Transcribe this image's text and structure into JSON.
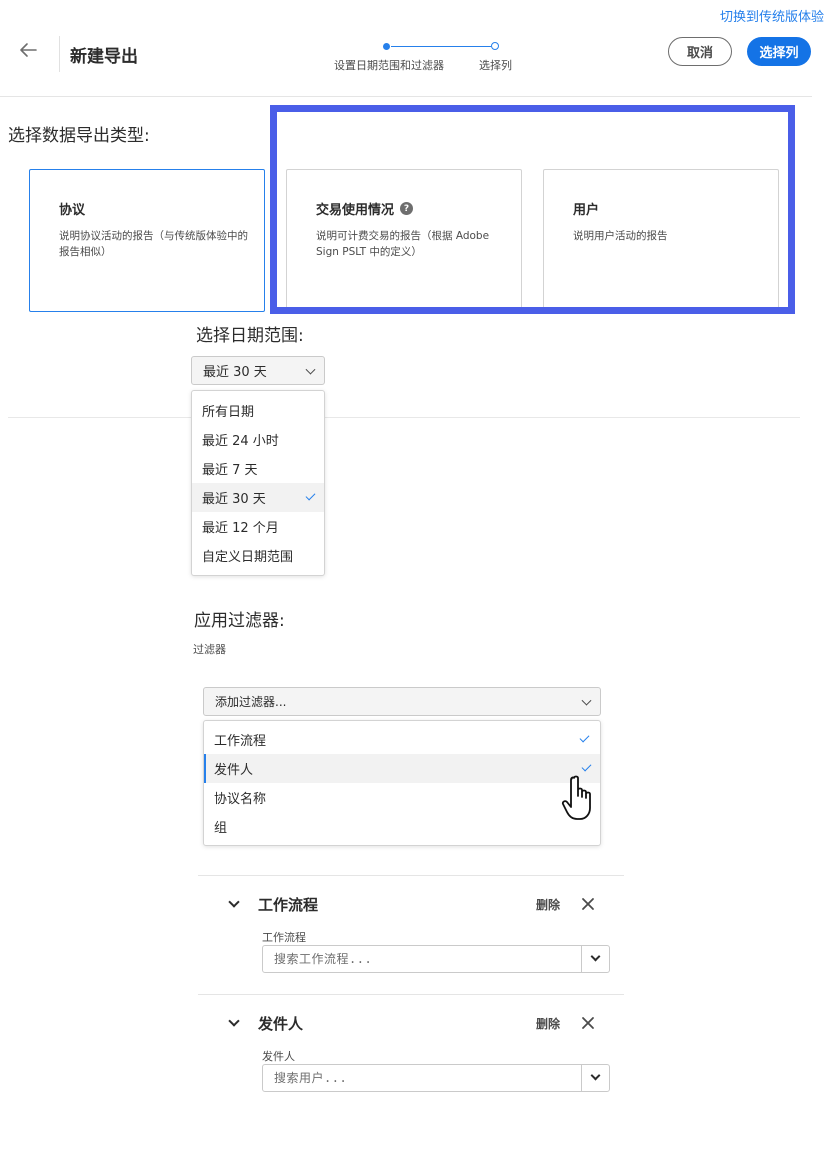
{
  "header": {
    "switch_link": "切换到传统版体验",
    "title": "新建导出",
    "steps": [
      {
        "label": "设置日期范围和过滤器"
      },
      {
        "label": "选择列"
      }
    ],
    "cancel_label": "取消",
    "select_columns_label": "选择列"
  },
  "export_type": {
    "heading": "选择数据导出类型:",
    "cards": [
      {
        "title": "协议",
        "description": "说明协议活动的报告（与传统版体验中的报告相似）"
      },
      {
        "title": "交易使用情况",
        "description": "说明可计费交易的报告（根据 Adobe Sign PSLT 中的定义）"
      },
      {
        "title": "用户",
        "description": "说明用户活动的报告"
      }
    ]
  },
  "date_range": {
    "heading": "选择日期范围:",
    "selected": "最近 30 天",
    "options": [
      "所有日期",
      "最近 24 小时",
      "最近 7 天",
      "最近 30 天",
      "最近 12 个月",
      "自定义日期范围"
    ]
  },
  "filters": {
    "heading": "应用过滤器:",
    "label": "过滤器",
    "add_placeholder": "添加过滤器...",
    "options": [
      "工作流程",
      "发件人",
      "协议名称",
      "组"
    ],
    "applied": [
      {
        "title": "工作流程",
        "delete_label": "删除",
        "field_label": "工作流程",
        "placeholder": "搜索工作流程..."
      },
      {
        "title": "发件人",
        "delete_label": "删除",
        "field_label": "发件人",
        "placeholder": "搜索用户..."
      }
    ]
  },
  "colors": {
    "accent": "#2680eb",
    "primary_button": "#1473e6",
    "highlight_box": "#4a5ee8"
  }
}
